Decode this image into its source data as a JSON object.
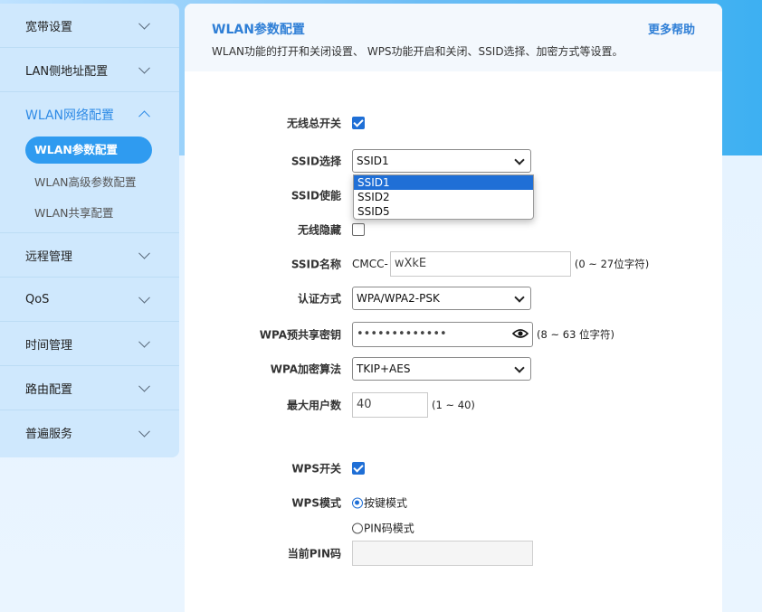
{
  "sidebar": {
    "items": [
      {
        "label": "宽带设置"
      },
      {
        "label": "LAN侧地址配置"
      },
      {
        "label": "WLAN网络配置"
      },
      {
        "label": "远程管理"
      },
      {
        "label": "QoS"
      },
      {
        "label": "时间管理"
      },
      {
        "label": "路由配置"
      },
      {
        "label": "普遍服务"
      }
    ],
    "sub_items": [
      {
        "label": "WLAN参数配置"
      },
      {
        "label": "WLAN高级参数配置"
      },
      {
        "label": "WLAN共享配置"
      }
    ]
  },
  "header": {
    "title": "WLAN参数配置",
    "help": "更多帮助",
    "description": "WLAN功能的打开和关闭设置、 WPS功能开启和关闭、SSID选择、加密方式等设置。"
  },
  "form": {
    "wireless_switch": {
      "label": "无线总开关",
      "checked": true
    },
    "ssid_select": {
      "label": "SSID选择",
      "value": "SSID1",
      "options": [
        "SSID1",
        "SSID2",
        "SSID5"
      ]
    },
    "ssid_enable": {
      "label": "SSID使能"
    },
    "wireless_hide": {
      "label": "无线隐藏",
      "checked": false
    },
    "ssid_name": {
      "label": "SSID名称",
      "prefix": "CMCC-",
      "value": "wXkE",
      "hint": "(0 ~ 27位字符)"
    },
    "auth_mode": {
      "label": "认证方式",
      "value": "WPA/WPA2-PSK"
    },
    "wpa_key": {
      "label": "WPA预共享密钥",
      "value": "•••••••••••••",
      "hint": "(8 ~ 63 位字符)"
    },
    "wpa_cipher": {
      "label": "WPA加密算法",
      "value": "TKIP+AES"
    },
    "max_users": {
      "label": "最大用户数",
      "value": "40",
      "hint": "(1 ~ 40)"
    },
    "wps_switch": {
      "label": "WPS开关",
      "checked": true
    },
    "wps_mode": {
      "label": "WPS模式",
      "options": [
        "按键模式",
        "PIN码模式"
      ],
      "selected": "按键模式"
    },
    "current_pin": {
      "label": "当前PIN码",
      "value": ""
    }
  },
  "colors": {
    "accent": "#2f8be6",
    "checkbox": "#1f6fd6"
  }
}
